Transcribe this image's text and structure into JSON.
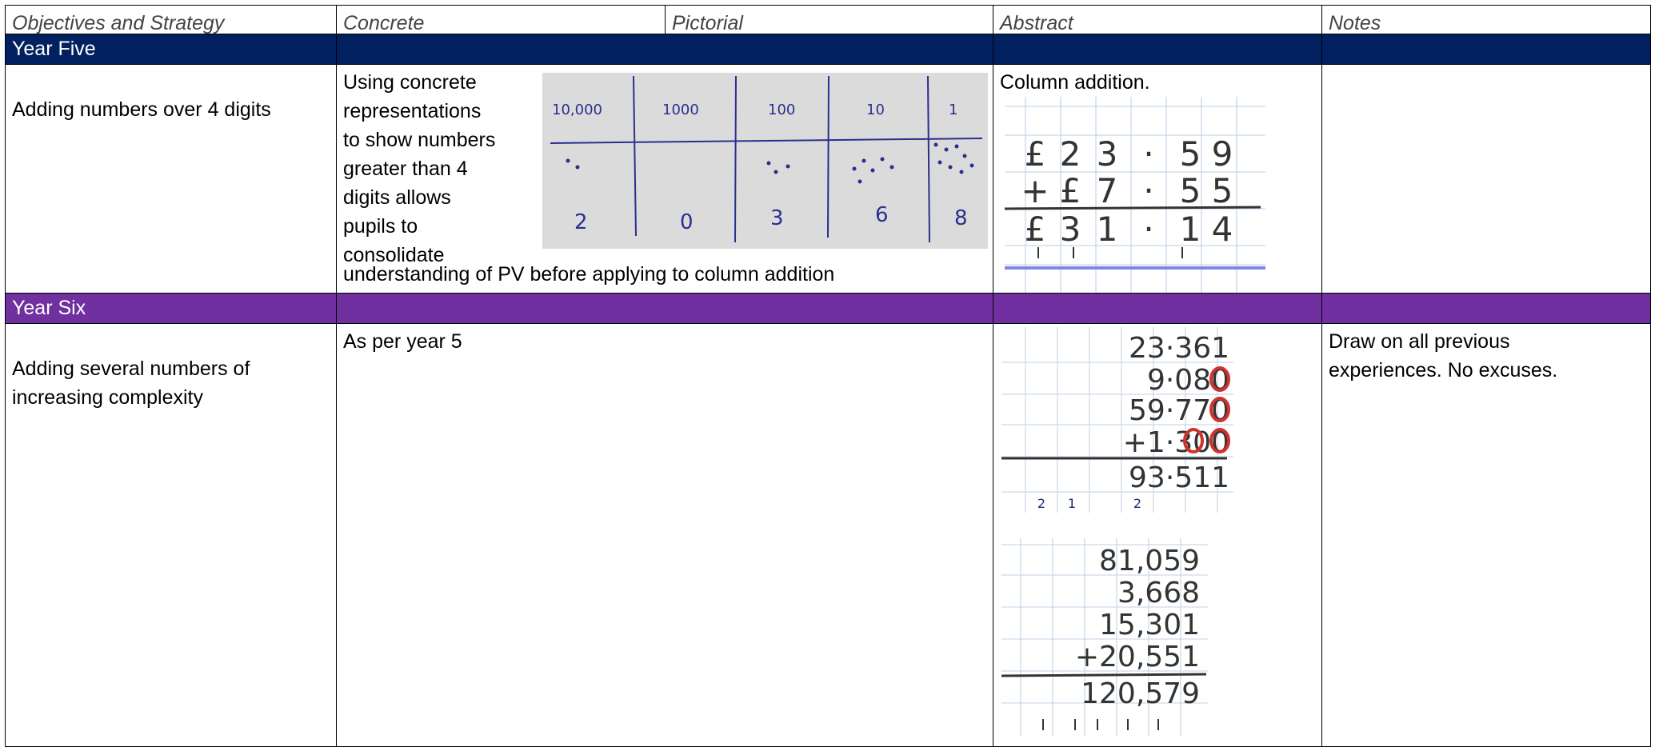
{
  "header": {
    "objectives": "Objectives and Strategy",
    "concrete": "Concrete",
    "pictorial": "Pictorial",
    "abstract": "Abstract",
    "notes": "Notes"
  },
  "year_five": {
    "band_label": "Year Five",
    "objective": "Adding numbers over 4 digits",
    "concrete_lines": [
      "Using concrete",
      "representations",
      "to show numbers",
      "greater than 4",
      "digits allows",
      "pupils to",
      "consolidate",
      "understanding of PV before applying to column addition"
    ],
    "place_value_chart": {
      "columns": [
        "10,000",
        "1000",
        "100",
        "10",
        "1"
      ],
      "digits": [
        "2",
        "0",
        "3",
        "6",
        "8"
      ]
    },
    "abstract_title": "Column addition.",
    "column_addition": {
      "row1": [
        "£",
        "2",
        "3",
        "·",
        "5",
        "9"
      ],
      "row2": [
        "+",
        "£",
        "7",
        "·",
        "5",
        "5"
      ],
      "row3": [
        "£",
        "3",
        "1",
        "·",
        "1",
        "4"
      ]
    },
    "notes": ""
  },
  "year_six": {
    "band_label": "Year Six",
    "objective_lines": [
      "Adding several numbers of",
      "increasing complexity"
    ],
    "concrete": "As per year 5",
    "decimal_sum": {
      "rows": [
        "23·361",
        "9·080",
        "59·770",
        "+1·300"
      ],
      "result": "93·511",
      "carries": [
        "2",
        "1",
        "2"
      ]
    },
    "whole_sum": {
      "rows": [
        "81,059",
        "3,668",
        "15,301",
        "+20,551"
      ],
      "result": "120,579"
    },
    "notes_lines": [
      "Draw on all previous",
      "experiences. No excuses."
    ]
  },
  "colors": {
    "year_five_band": "#012060",
    "year_six_band": "#7030a0",
    "placeholder_zero": "#d0312d",
    "pen_blue": "#2a2f8f"
  }
}
